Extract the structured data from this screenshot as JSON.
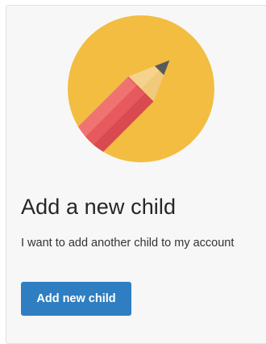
{
  "card": {
    "title": "Add a new child",
    "description": "I want to add another child to my account",
    "button_label": "Add new child",
    "icon": "pencil-icon"
  },
  "colors": {
    "circle": "#f2bd40",
    "pencil_body_light": "#f07373",
    "pencil_body_mid": "#e65a5e",
    "pencil_body_dark": "#d94a50",
    "pencil_wood": "#f6d38c",
    "pencil_lead": "#5a5a5a",
    "button": "#2f7ec1"
  }
}
